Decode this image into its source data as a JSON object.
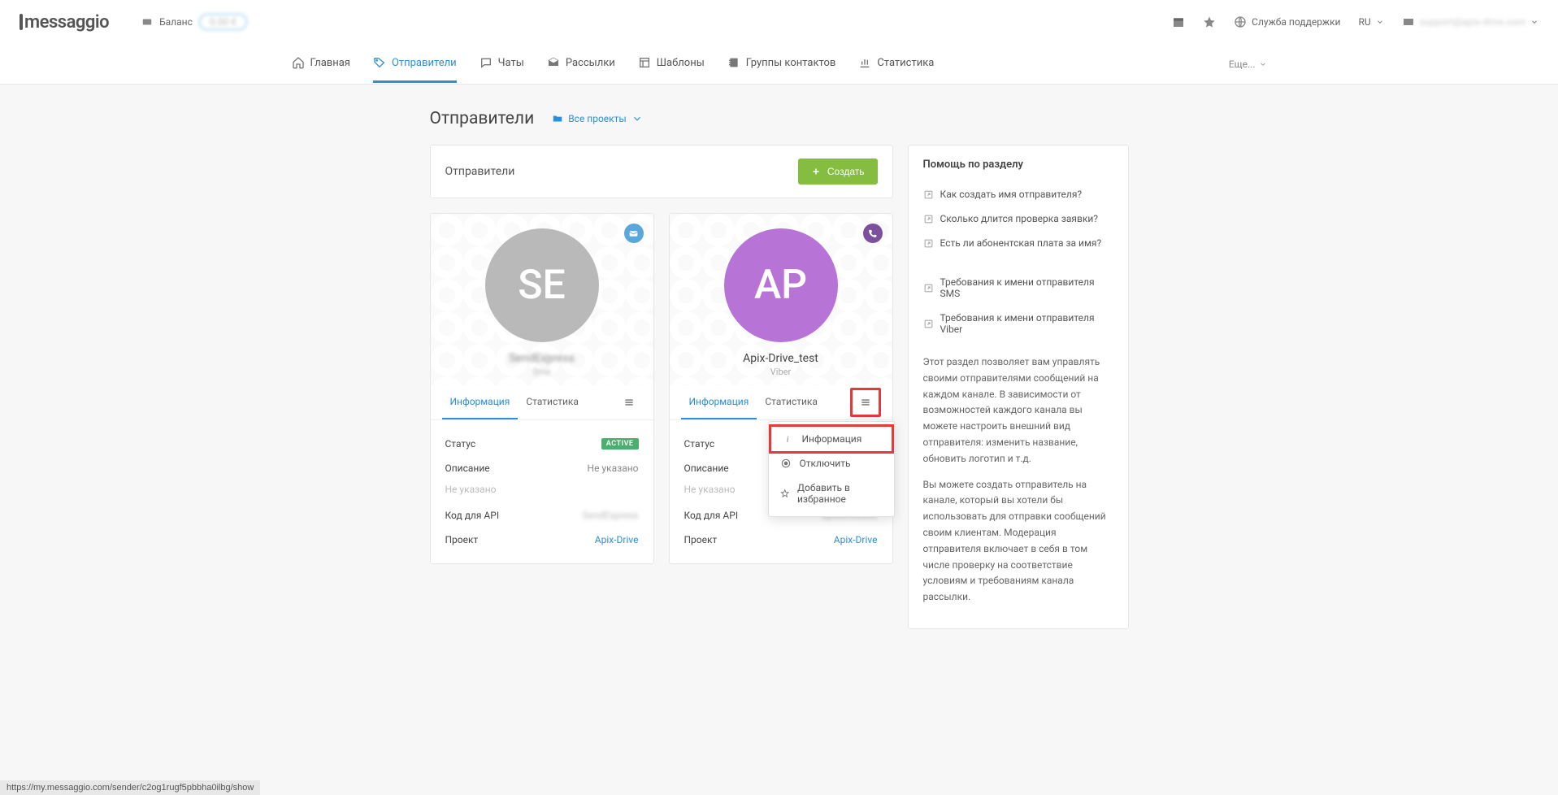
{
  "logo_text": "messaggio",
  "balance_label": "Баланс",
  "balance_value": "0.00 €",
  "topbar": {
    "support": "Служба поддержки",
    "lang": "RU",
    "user": "support@apix-drive.com"
  },
  "nav": {
    "home": "Главная",
    "senders": "Отправители",
    "chats": "Чаты",
    "campaigns": "Рассылки",
    "templates": "Шаблоны",
    "contacts": "Группы контактов",
    "stats": "Статистика",
    "more": "Еще..."
  },
  "page": {
    "title": "Отправители",
    "projects_dd": "Все проекты"
  },
  "panel": {
    "title": "Отправители",
    "create_btn": "Создать"
  },
  "tabs": {
    "info": "Информация",
    "stats": "Статистика"
  },
  "labels": {
    "status": "Статус",
    "desc": "Описание",
    "not_specified": "Не указано",
    "api_code": "Код для API",
    "project": "Проект"
  },
  "card1": {
    "initials": "SE",
    "name": "SendExpress",
    "channel": "Sms",
    "status_badge": "ACTIVE",
    "api_val": "SendExpress",
    "project_val": "Apix-Drive"
  },
  "card2": {
    "initials": "AP",
    "name": "Apix-Drive_test",
    "channel": "Viber",
    "api_val": "apixdrivetest",
    "project_val": "Apix-Drive"
  },
  "dropdown": {
    "info": "Информация",
    "disable": "Отключить",
    "fav": "Добавить в избранное"
  },
  "help": {
    "title": "Помощь по разделу",
    "q1": "Как создать имя отправителя?",
    "q2": "Сколько длится проверка заявки?",
    "q3": "Есть ли абонентская плата за имя?",
    "q4": "Требования к имени отправителя SMS",
    "q5": "Требования к имени отправителя Viber",
    "p1": "Этот раздел позволяет вам управлять своими отправителями сообщений на каждом канале. В зависимости от возможностей каждого канала вы можете настроить внешний вид отправителя: изменить название, обновить логотип и т.д.",
    "p2": "Вы можете создать отправитель на канале, который вы хотели бы использовать для отправки сообщений своим клиентам. Модерация отправителя включает в себя в том числе проверку на соответствие условиям и требованиям канала рассылки."
  },
  "status_url": "https://my.messaggio.com/sender/c2og1rugf5pbbha0ilbg/show"
}
